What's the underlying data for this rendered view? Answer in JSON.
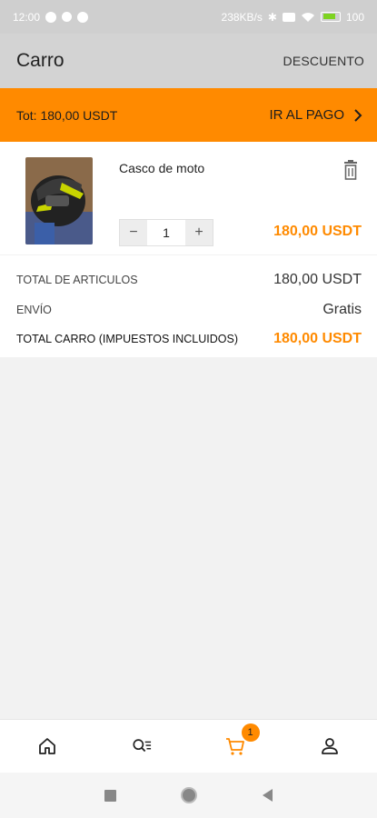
{
  "status_bar": {
    "time": "12:00",
    "speed": "238KB/s",
    "battery": "100"
  },
  "header": {
    "title": "Carro",
    "discount_label": "DESCUENTO"
  },
  "checkout_bar": {
    "total_text": "Tot: 180,00 USDT",
    "checkout_label": "IR AL PAGO"
  },
  "cart": {
    "items": [
      {
        "name": "Casco de moto",
        "quantity": "1",
        "price": "180,00 USDT"
      }
    ]
  },
  "summary": {
    "items_total_label": "TOTAL DE ARTICULOS",
    "items_total_value": "180,00 USDT",
    "shipping_label": "ENVÍO",
    "shipping_value": "Gratis",
    "cart_total_label": "TOTAL CARRO (IMPUESTOS INCLUIDOS)",
    "cart_total_value": "180,00 USDT"
  },
  "bottom_nav": {
    "cart_badge": "1",
    "active_tab": "cart",
    "icons": [
      "home-icon",
      "search-list-icon",
      "cart-icon",
      "user-icon"
    ]
  },
  "colors": {
    "accent": "#ff8a00",
    "header_bg": "#d3d3d3"
  }
}
